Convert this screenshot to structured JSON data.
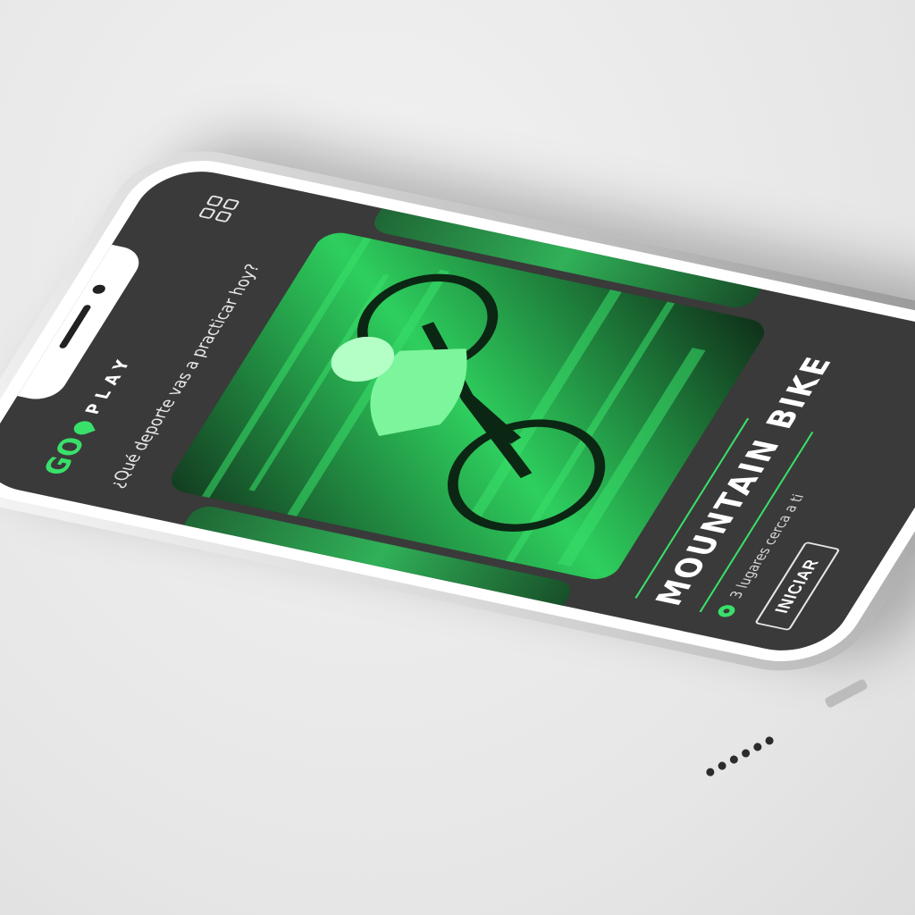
{
  "app": {
    "logo_go": "GO",
    "logo_play": "PLAY"
  },
  "header": {
    "menu_icon": "grid-icon"
  },
  "prompt": {
    "question": "¿Qué deporte vas a practicar hoy?"
  },
  "sport": {
    "title": "MOUNTAIN BIKE",
    "places": "3 lugares cerca a ti",
    "place_icon": "location-pin-icon",
    "start_label": "INICIAR"
  },
  "colors": {
    "accent": "#39e06a",
    "screen_bg": "#3a3a3a",
    "text": "#ffffff"
  }
}
